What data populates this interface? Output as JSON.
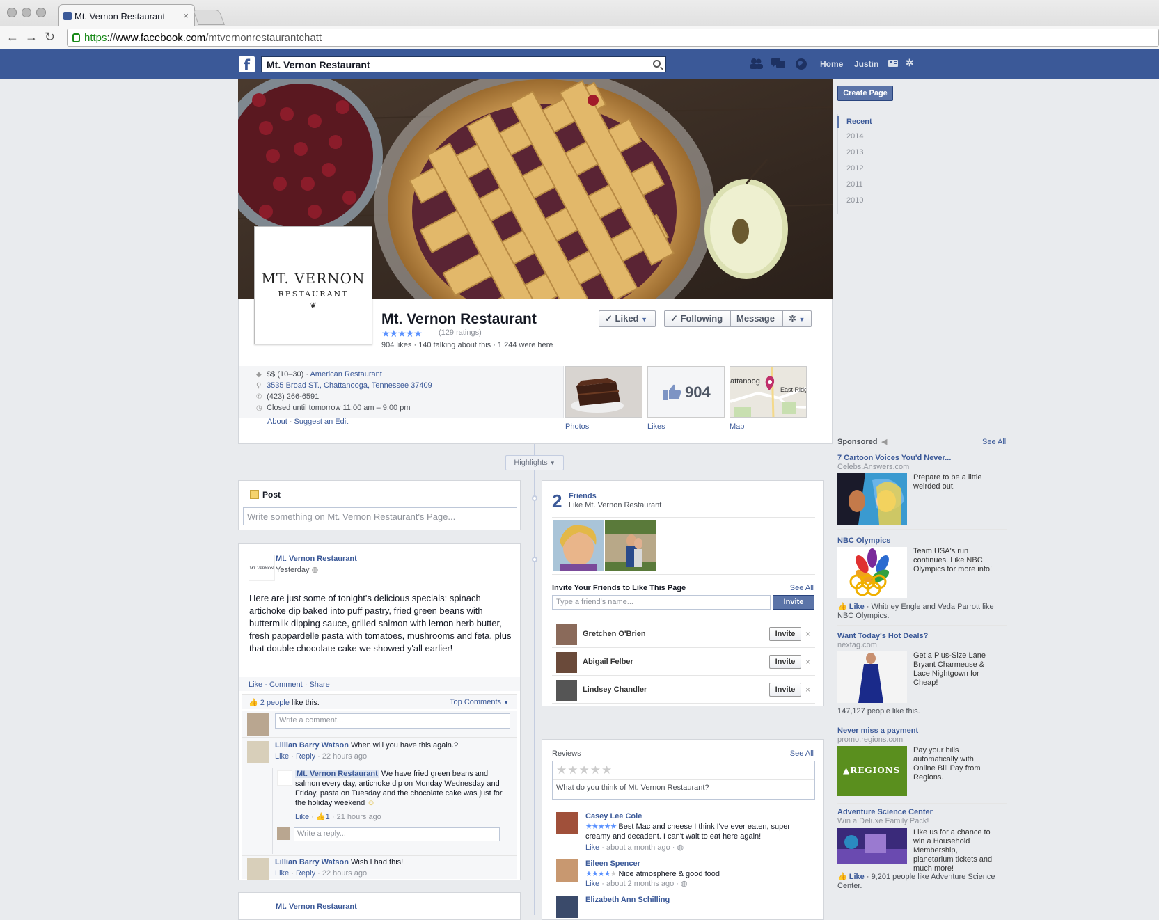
{
  "browser": {
    "tab_title": "Mt. Vernon Restaurant",
    "url_scheme": "https",
    "url_sep": "://",
    "url_domain": "www.facebook.com",
    "url_path": "/mtvernonrestaurantchatt"
  },
  "topbar": {
    "search_value": "Mt. Vernon Restaurant",
    "home": "Home",
    "user": "Justin"
  },
  "page": {
    "logo_line1": "MT. VERNON",
    "logo_line2": "RESTAURANT",
    "name": "Mt. Vernon Restaurant",
    "stars": "★★★★★",
    "rating_value": 4.5,
    "ratings": "(129 ratings)",
    "stats": "904 likes · 140 talking about this · 1,244 were here",
    "liked_btn": "Liked",
    "following_btn": "Following",
    "message_btn": "Message",
    "price": "$$ (10–30) ·",
    "category": "American Restaurant",
    "address": "3535 Broad ST., Chattanooga, Tennessee 37409",
    "phone": "(423) 266-6591",
    "hours": "Closed until tomorrow 11:00 am – 9:00 pm",
    "about": "About",
    "suggest_sep": "·",
    "suggest": "Suggest an Edit",
    "photos_label": "Photos",
    "likes_count": "904",
    "likes_label": "Likes",
    "map_label": "Map",
    "map_text_a": "attanoog",
    "map_text_b": "East Ridg"
  },
  "highlights": "Highlights",
  "composer": {
    "label": "Post",
    "placeholder": "Write something on Mt. Vernon Restaurant's Page..."
  },
  "post": {
    "author": "Mt. Vernon Restaurant",
    "time": "Yesterday",
    "body": "Here are just some of tonight's delicious specials: spinach artichoke dip baked into puff pastry, fried green beans with buttermilk dipping sauce, grilled salmon with lemon herb butter, fresh pappardelle pasta with tomatoes, mushrooms and feta, plus that double chocolate cake we showed y'all earlier!",
    "like": "Like",
    "comment": "Comment",
    "share": "Share",
    "people_count": "2 people",
    "people_suffix": "like this.",
    "top_comments": "Top Comments",
    "comment_placeholder": "Write a comment...",
    "c1_author": "Lillian Barry Watson",
    "c1_text": "When will you have this again.?",
    "c1_time": "22 hours ago",
    "reply_author": "Mt. Vernon Restaurant",
    "reply_text": "We have fried green beans and salmon every day, artichoke dip on Monday Wednesday and Friday, pasta on Tuesday and the chocolate cake was just for the holiday weekend",
    "reply_likes": "1",
    "reply_time": "21 hours ago",
    "reply_placeholder": "Write a reply...",
    "c2_author": "Lillian Barry Watson",
    "c2_text": "Wish I had this!",
    "c2_time": "22 hours ago",
    "reply": "Reply",
    "next_author": "Mt. Vernon Restaurant"
  },
  "friends": {
    "count": "2",
    "label": "Friends",
    "sub": "Like Mt. Vernon Restaurant",
    "invite_title": "Invite Your Friends to Like This Page",
    "see_all": "See All",
    "input_placeholder": "Type a friend's name...",
    "invite_btn": "Invite",
    "list": [
      "Gretchen O'Brien",
      "Abigail Felber",
      "Lindsey Chandler"
    ]
  },
  "reviews": {
    "title": "Reviews",
    "see_all": "See All",
    "empty_stars": "★★★★★",
    "prompt": "What do you think of Mt. Vernon Restaurant?",
    "r1_name": "Casey Lee Cole",
    "r1_stars": "★★★★★",
    "r1_rating": 5,
    "r1_text": "Best Mac and cheese I think I've ever eaten, super creamy and decadent. I can't wait to eat here again!",
    "r1_time": "about a month ago",
    "r2_name": "Eileen Spencer",
    "r2_stars": "★★★★★",
    "r2_rating": 4,
    "r2_text": "Nice atmosphere & good food",
    "r2_time": "about 2 months ago",
    "r3_name": "Elizabeth Ann Schilling"
  },
  "sidebar": {
    "create_page": "Create Page",
    "years": [
      "Recent",
      "2014",
      "2013",
      "2012",
      "2011",
      "2010"
    ],
    "sponsored": "Sponsored",
    "see_all": "See All"
  },
  "ads": [
    {
      "title": "7 Cartoon Voices You'd Never...",
      "src": "Celebs.Answers.com",
      "body": "Prepare to be a little weirded out."
    },
    {
      "title": "NBC Olympics",
      "body": "Team USA's run continues. Like NBC Olympics for more info!",
      "like": "Like",
      "social": "· Whitney Engle and Veda Parrott like NBC Olympics."
    },
    {
      "title": "Want Today's Hot Deals?",
      "src": "nextag.com",
      "body": "Get a Plus-Size Lane Bryant Charmeuse & Lace Nightgown for Cheap!",
      "social": "147,127 people like this."
    },
    {
      "title": "Never miss a payment",
      "src": "promo.regions.com",
      "body": "Pay your bills automatically with Online Bill Pay from Regions.",
      "logo": "REGIONS"
    },
    {
      "title": "Adventure Science Center",
      "src": "Win a Deluxe Family Pack!",
      "body": "Like us for a chance to win a Household Membership, planetarium tickets and much more!",
      "like": "Like",
      "social": "· 9,201 people like Adventure Science Center."
    }
  ],
  "colors": {
    "brand": "#3b5998",
    "star": "#5890ff",
    "regions_green": "#5a8f1e"
  }
}
